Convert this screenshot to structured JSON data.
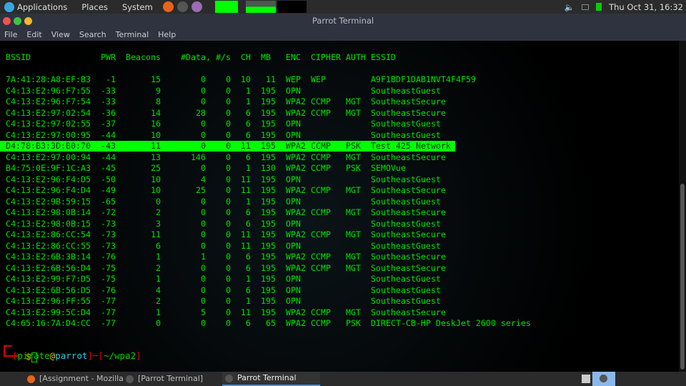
{
  "topbar": {
    "menus": [
      "Applications",
      "Places",
      "System"
    ],
    "clock": "Thu Oct 31, 16:32"
  },
  "window": {
    "title": "Parrot Terminal",
    "menu": [
      "File",
      "Edit",
      "View",
      "Search",
      "Terminal",
      "Help"
    ]
  },
  "airodump": {
    "headers": [
      "BSSID",
      "PWR",
      "Beacons",
      "#Data, #/s",
      "CH",
      "MB",
      "ENC",
      "CIPHER",
      "AUTH",
      "ESSID"
    ],
    "highlight_color": "#00ff00",
    "text_color": "#00e000",
    "rows": [
      [
        "7A:41:28:A8:EF:B3",
        "-1",
        "15",
        "0",
        "0",
        "10",
        "11",
        "WEP",
        "WEP",
        "",
        "A9F1BDF1DAB1NVT4F4F59"
      ],
      [
        "C4:13:E2:96:F7:55",
        "-33",
        "9",
        "0",
        "0",
        "1",
        "195",
        "OPN",
        "",
        "",
        "SoutheastGuest"
      ],
      [
        "C4:13:E2:96:F7:54",
        "-33",
        "8",
        "0",
        "0",
        "1",
        "195",
        "WPA2",
        "CCMP",
        "MGT",
        "SoutheastSecure"
      ],
      [
        "C4:13:E2:97:02:54",
        "-36",
        "14",
        "28",
        "0",
        "6",
        "195",
        "WPA2",
        "CCMP",
        "MGT",
        "SoutheastSecure"
      ],
      [
        "C4:13:E2:97:02:55",
        "-37",
        "16",
        "0",
        "0",
        "6",
        "195",
        "OPN",
        "",
        "",
        "SoutheastGuest"
      ],
      [
        "C4:13:E2:97:00:95",
        "-44",
        "10",
        "0",
        "0",
        "6",
        "195",
        "OPN",
        "",
        "",
        "SoutheastGuest"
      ],
      [
        "D4:78:B3:3D:B0:70",
        "-43",
        "11",
        "0",
        "0",
        "11",
        "195",
        "WPA2",
        "CCMP",
        "PSK",
        "Test 425 Network"
      ],
      [
        "C4:13:E2:97:00:94",
        "-44",
        "13",
        "146",
        "0",
        "6",
        "195",
        "WPA2",
        "CCMP",
        "MGT",
        "SoutheastSecure"
      ],
      [
        "B4:75:0E:9F:1C:A3",
        "-45",
        "25",
        "0",
        "0",
        "1",
        "130",
        "WPA2",
        "CCMP",
        "PSK",
        "SEMOVue"
      ],
      [
        "C4:13:E2:96:F4:D5",
        "-50",
        "10",
        "4",
        "0",
        "11",
        "195",
        "OPN",
        "",
        "",
        "SoutheastGuest"
      ],
      [
        "C4:13:E2:96:F4:D4",
        "-49",
        "10",
        "25",
        "0",
        "11",
        "195",
        "WPA2",
        "CCMP",
        "MGT",
        "SoutheastSecure"
      ],
      [
        "C4:13:E2:9B:59:15",
        "-65",
        "0",
        "0",
        "0",
        "1",
        "195",
        "OPN",
        "",
        "",
        "SoutheastGuest"
      ],
      [
        "C4:13:E2:98:0B:14",
        "-72",
        "2",
        "0",
        "0",
        "6",
        "195",
        "WPA2",
        "CCMP",
        "MGT",
        "SoutheastSecure"
      ],
      [
        "C4:13:E2:98:0B:15",
        "-73",
        "3",
        "0",
        "0",
        "6",
        "195",
        "OPN",
        "",
        "",
        "SoutheastGuest"
      ],
      [
        "C4:13:E2:86:CC:54",
        "-73",
        "11",
        "0",
        "0",
        "11",
        "195",
        "WPA2",
        "CCMP",
        "MGT",
        "SoutheastSecure"
      ],
      [
        "C4:13:E2:86:CC:55",
        "-73",
        "6",
        "0",
        "0",
        "11",
        "195",
        "OPN",
        "",
        "",
        "SoutheastGuest"
      ],
      [
        "C4:13:E2:6B:3B:14",
        "-76",
        "1",
        "1",
        "0",
        "6",
        "195",
        "WPA2",
        "CCMP",
        "MGT",
        "SoutheastSecure"
      ],
      [
        "C4:13:E2:6B:56:D4",
        "-75",
        "2",
        "0",
        "0",
        "6",
        "195",
        "WPA2",
        "CCMP",
        "MGT",
        "SoutheastSecure"
      ],
      [
        "C4:13:E2:99:F7:D5",
        "-75",
        "1",
        "0",
        "0",
        "1",
        "195",
        "OPN",
        "",
        "",
        "SoutheastGuest"
      ],
      [
        "C4:13:E2:6B:56:D5",
        "-76",
        "4",
        "0",
        "0",
        "6",
        "195",
        "OPN",
        "",
        "",
        "SoutheastGuest"
      ],
      [
        "C4:13:E2:96:FF:55",
        "-77",
        "2",
        "0",
        "0",
        "1",
        "195",
        "OPN",
        "",
        "",
        "SoutheastGuest"
      ],
      [
        "C4:13:E2:99:5C:D4",
        "-77",
        "1",
        "5",
        "0",
        "11",
        "195",
        "WPA2",
        "CCMP",
        "MGT",
        "SoutheastSecure"
      ],
      [
        "C4:65:16:7A:D4:CC",
        "-77",
        "0",
        "0",
        "0",
        "6",
        "65",
        "WPA2",
        "CCMP",
        "PSK",
        "DIRECT-CB-HP DeskJet 2600 series"
      ]
    ],
    "highlighted_row": 6
  },
  "prompt": {
    "user": "pirate",
    "at": "@",
    "host": "parrot",
    "path": "~/wpa2",
    "symbol": "$"
  },
  "taskbar": {
    "items": [
      "[Assignment - Mozilla ...",
      "[Parrot Terminal]",
      "Parrot Terminal"
    ]
  }
}
